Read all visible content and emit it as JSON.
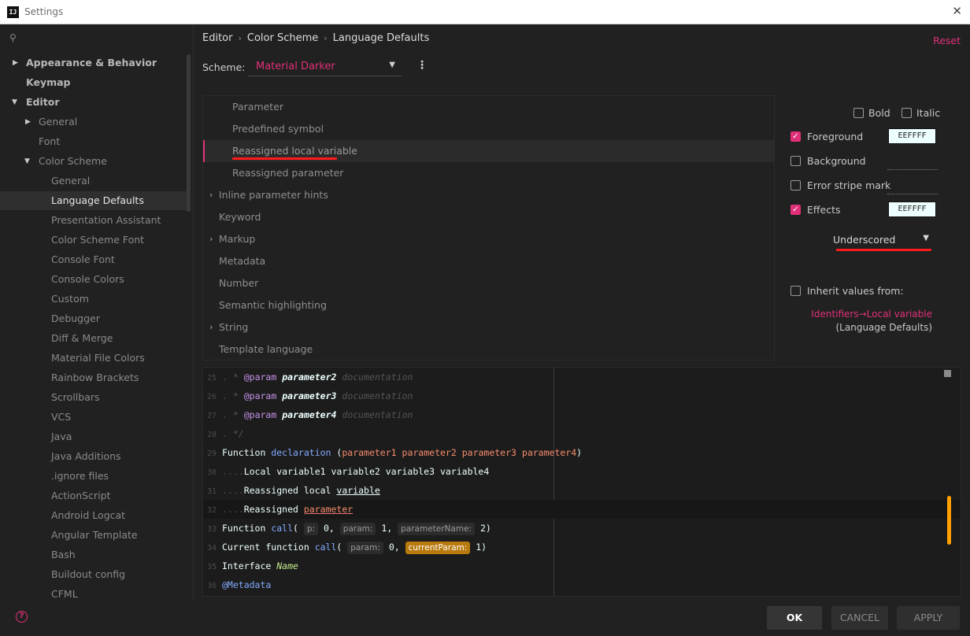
{
  "window": {
    "title": "Settings",
    "app_icon": "IJ"
  },
  "sidebar": {
    "items": [
      {
        "label": "Appearance & Behavior"
      },
      {
        "label": "Keymap"
      },
      {
        "label": "Editor"
      },
      {
        "label": "General"
      },
      {
        "label": "Font"
      },
      {
        "label": "Color Scheme"
      },
      {
        "label": "General"
      },
      {
        "label": "Language Defaults"
      },
      {
        "label": "Presentation Assistant"
      },
      {
        "label": "Color Scheme Font"
      },
      {
        "label": "Console Font"
      },
      {
        "label": "Console Colors"
      },
      {
        "label": "Custom"
      },
      {
        "label": "Debugger"
      },
      {
        "label": "Diff & Merge"
      },
      {
        "label": "Material File Colors"
      },
      {
        "label": "Rainbow Brackets"
      },
      {
        "label": "Scrollbars"
      },
      {
        "label": "VCS"
      },
      {
        "label": "Java"
      },
      {
        "label": "Java Additions"
      },
      {
        "label": ".ignore files"
      },
      {
        "label": "ActionScript"
      },
      {
        "label": "Android Logcat"
      },
      {
        "label": "Angular Template"
      },
      {
        "label": "Bash"
      },
      {
        "label": "Buildout config"
      },
      {
        "label": "CFML"
      }
    ]
  },
  "breadcrumb": {
    "items": [
      "Editor",
      "Color Scheme",
      "Language Defaults"
    ]
  },
  "header": {
    "reset_label": "Reset",
    "scheme_label": "Scheme:",
    "scheme_value": "Material Darker"
  },
  "attributes": {
    "items": [
      {
        "label": "Parameter"
      },
      {
        "label": "Predefined symbol"
      },
      {
        "label": "Reassigned local variable"
      },
      {
        "label": "Reassigned parameter"
      },
      {
        "label": "Inline parameter hints"
      },
      {
        "label": "Keyword"
      },
      {
        "label": "Markup"
      },
      {
        "label": "Metadata"
      },
      {
        "label": "Number"
      },
      {
        "label": "Semantic highlighting"
      },
      {
        "label": "String"
      },
      {
        "label": "Template language"
      }
    ]
  },
  "props": {
    "bold_label": "Bold",
    "italic_label": "Italic",
    "foreground_label": "Foreground",
    "foreground_value": "EEFFFF",
    "background_label": "Background",
    "error_stripe_label": "Error stripe mark",
    "effects_label": "Effects",
    "effects_value": "EEFFFF",
    "effect_type": "Underscored",
    "inherit_label": "Inherit values from:",
    "inherit_link": "Identifiers→Local variable",
    "inherit_sub": "(Language Defaults)",
    "foreground_checked": true,
    "effects_checked": true,
    "bold_checked": false,
    "italic_checked": false,
    "background_checked": false,
    "error_stripe_checked": false,
    "inherit_checked": false
  },
  "preview": {
    "lines": [
      {
        "num": "25",
        "text": "  * @param parameter2 documentation"
      },
      {
        "num": "26",
        "text": "  * @param parameter3 documentation"
      },
      {
        "num": "27",
        "text": "  * @param parameter4 documentation"
      },
      {
        "num": "28",
        "text": "  */"
      },
      {
        "num": "29",
        "text": "Function declaration (parameter1 parameter2 parameter3 parameter4)"
      },
      {
        "num": "30",
        "text": "....Local variable1 variable2 variable3 variable4"
      },
      {
        "num": "31",
        "text": "....Reassigned local variable"
      },
      {
        "num": "32",
        "text": "....Reassigned parameter"
      },
      {
        "num": "33",
        "text": "Function call( p: 0, param: 1, parameterName: 2)"
      },
      {
        "num": "34",
        "text": "Current function call( param: 0, currentParam: 1)"
      },
      {
        "num": "35",
        "text": "Interface Name"
      },
      {
        "num": "36",
        "text": "@Metadata"
      }
    ]
  },
  "footer": {
    "help_icon": "?",
    "ok_label": "OK",
    "cancel_label": "CANCEL",
    "apply_label": "APPLY"
  },
  "colors": {
    "accent": "#e0307a",
    "swatch": "#eeffff",
    "hint_current": "#b8790d",
    "scroll_marker": "#ffa000"
  }
}
